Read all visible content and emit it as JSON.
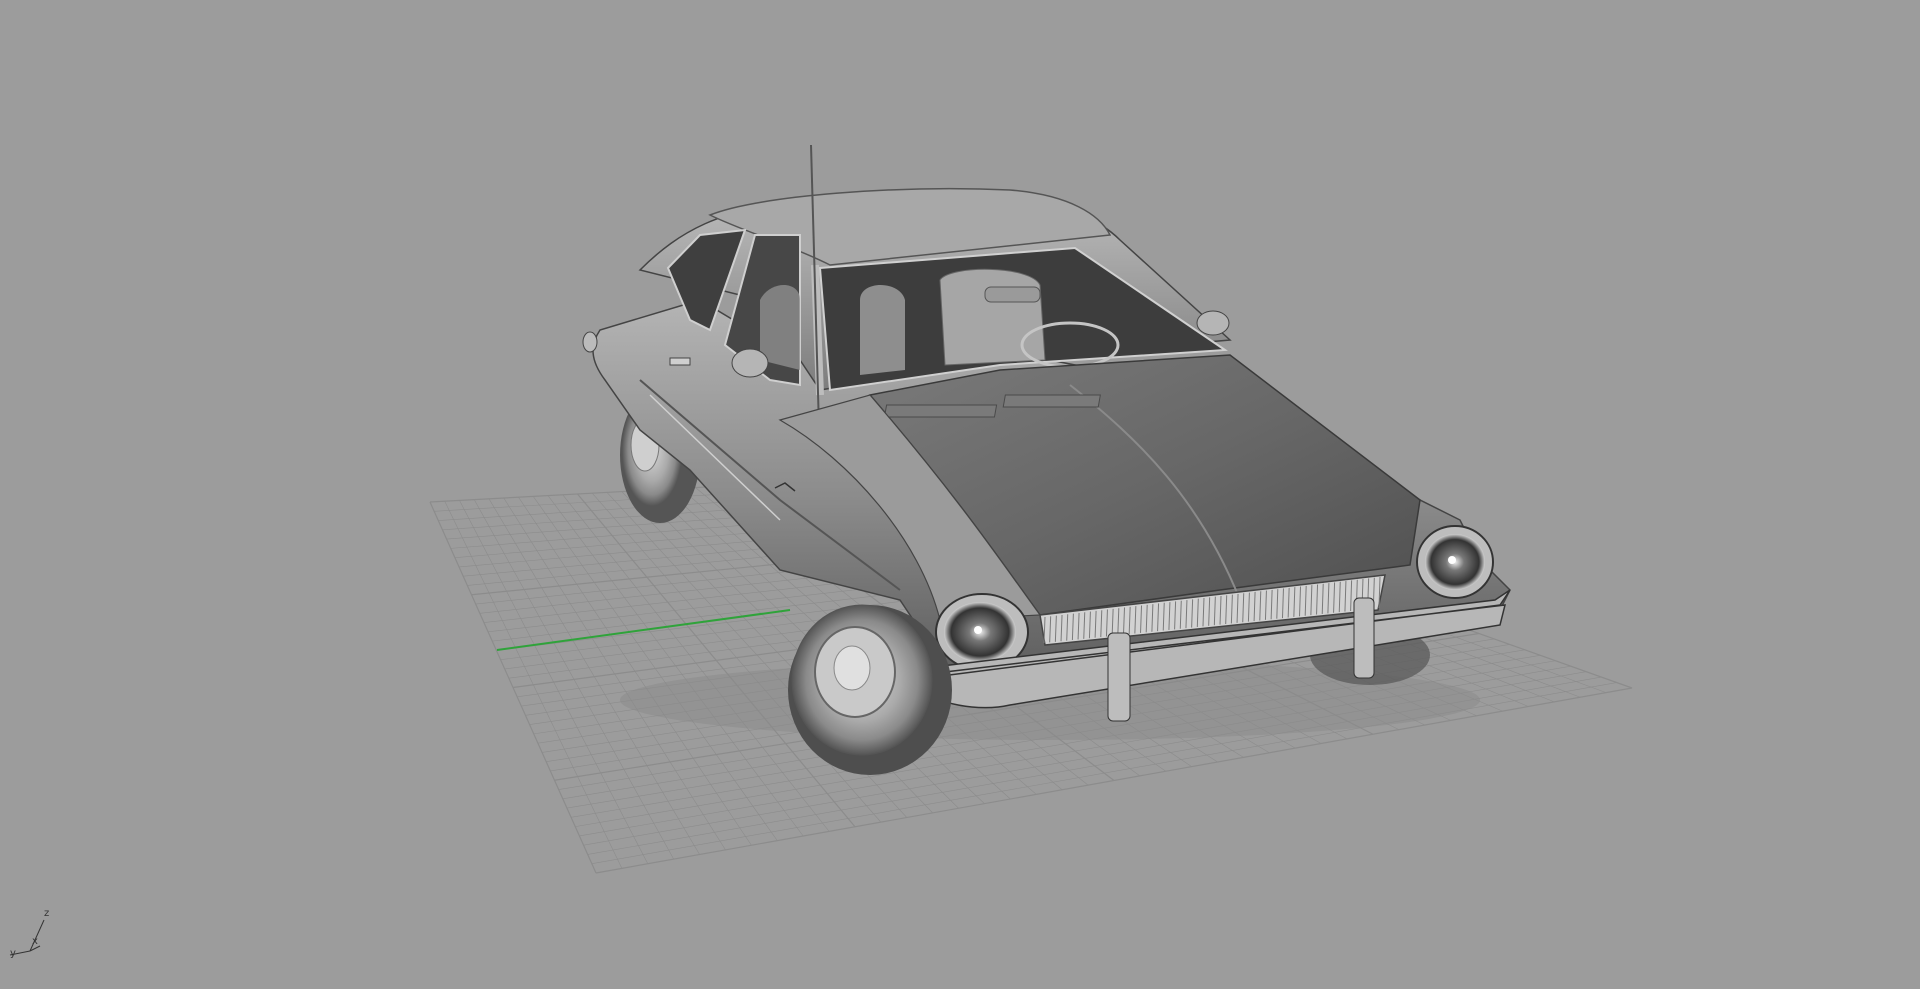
{
  "viewport": {
    "background": "#9c9c9c",
    "grid_color": "#8c8c8c",
    "x_axis_color": "#2fa33a",
    "model": "car-render",
    "model_color": "#8a8a8a"
  },
  "axis_widget": {
    "z_label": "z",
    "y_label": "y",
    "x_label": "x"
  }
}
